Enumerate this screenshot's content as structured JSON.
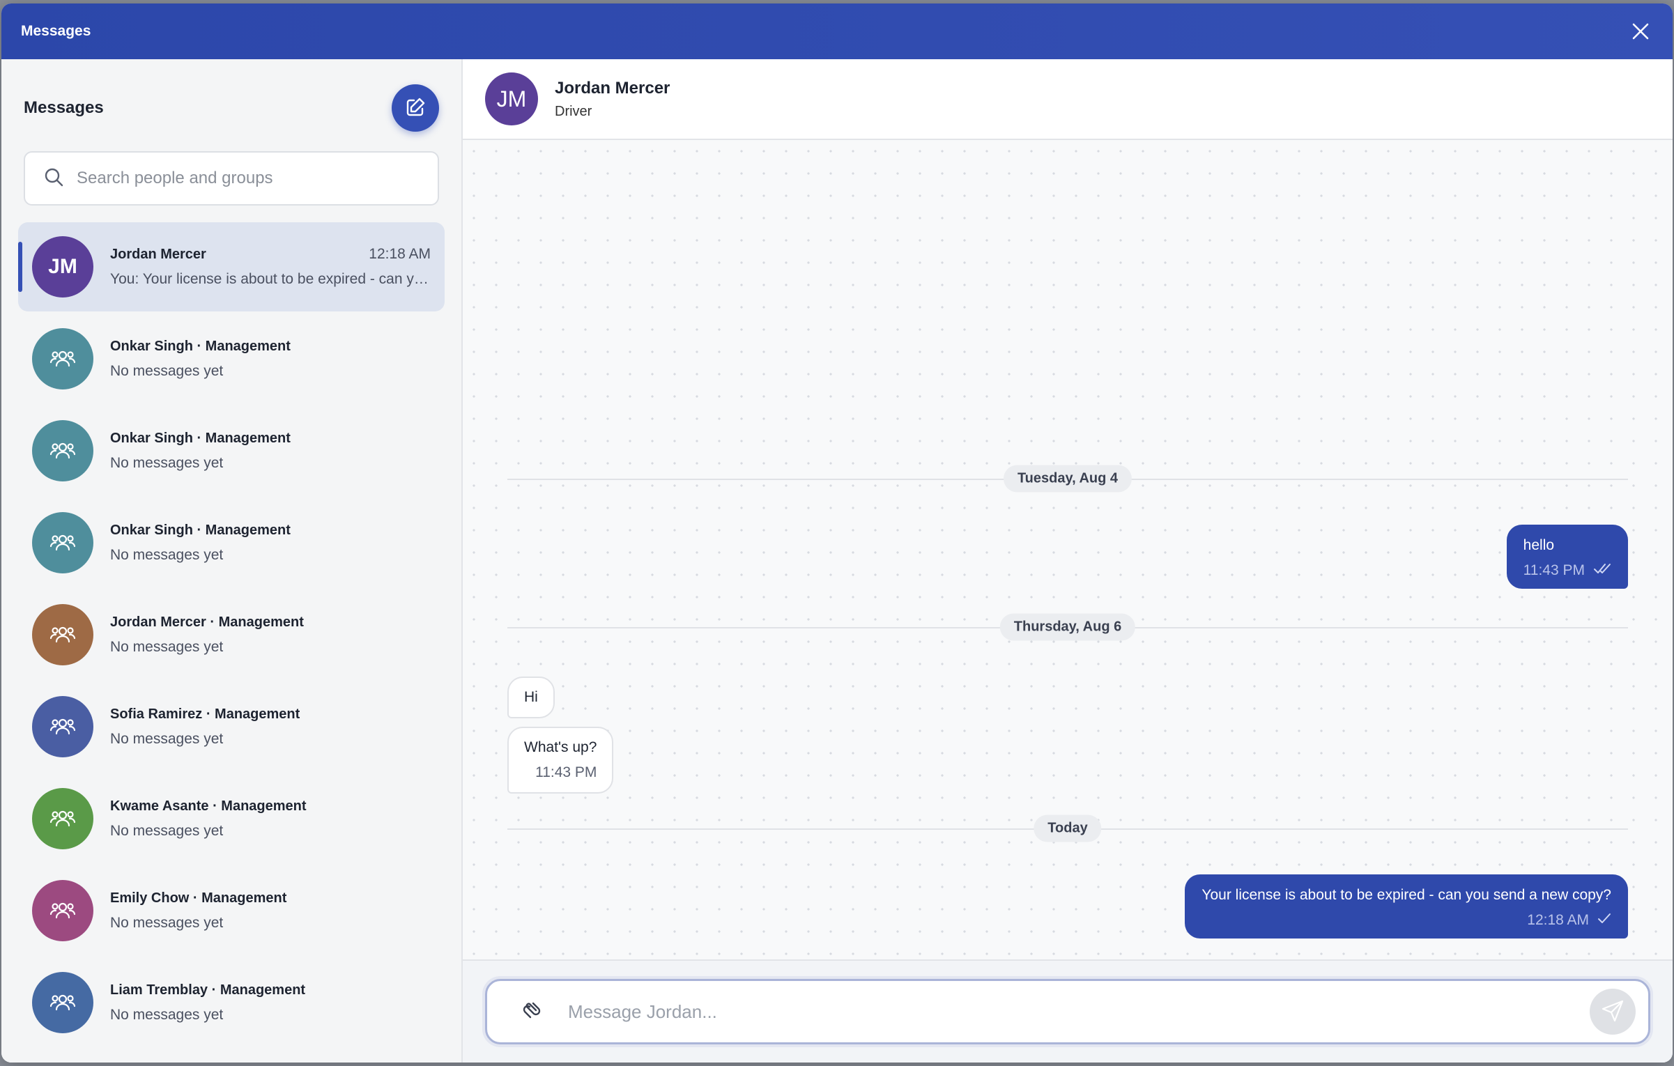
{
  "window": {
    "title": "Messages"
  },
  "sidebar": {
    "title": "Messages",
    "search_placeholder": "Search people and groups",
    "conversations": [
      {
        "name": "Jordan Mercer",
        "time": "12:18 AM",
        "preview": "You: Your license is about to be expired - can you send a new copy?",
        "initials": "JM",
        "color": "#5a3f98",
        "type": "person",
        "active": true
      },
      {
        "name": "Onkar Singh · Management",
        "time": "",
        "preview": "No messages yet",
        "initials": "",
        "color": "#4f8e9c",
        "type": "group",
        "active": false
      },
      {
        "name": "Onkar Singh · Management",
        "time": "",
        "preview": "No messages yet",
        "initials": "",
        "color": "#4f8e9c",
        "type": "group",
        "active": false
      },
      {
        "name": "Onkar Singh · Management",
        "time": "",
        "preview": "No messages yet",
        "initials": "",
        "color": "#4f8e9c",
        "type": "group",
        "active": false
      },
      {
        "name": "Jordan Mercer · Management",
        "time": "",
        "preview": "No messages yet",
        "initials": "",
        "color": "#9e6a45",
        "type": "group",
        "active": false
      },
      {
        "name": "Sofia Ramirez · Management",
        "time": "",
        "preview": "No messages yet",
        "initials": "",
        "color": "#4a5ea3",
        "type": "group",
        "active": false
      },
      {
        "name": "Kwame Asante · Management",
        "time": "",
        "preview": "No messages yet",
        "initials": "",
        "color": "#5a9a48",
        "type": "group",
        "active": false
      },
      {
        "name": "Emily Chow · Management",
        "time": "",
        "preview": "No messages yet",
        "initials": "",
        "color": "#9c4a80",
        "type": "group",
        "active": false
      },
      {
        "name": "Liam Tremblay · Management",
        "time": "",
        "preview": "No messages yet",
        "initials": "",
        "color": "#456aa3",
        "type": "group",
        "active": false
      }
    ]
  },
  "chat": {
    "header": {
      "initials": "JM",
      "name": "Jordan Mercer",
      "role": "Driver",
      "color": "#5a3f98"
    },
    "dividers": [
      "Tuesday, Aug 4",
      "Thursday, Aug 6",
      "Today"
    ],
    "messages": [
      {
        "direction": "out",
        "text": "hello",
        "time": "11:43 PM",
        "status": "read"
      },
      {
        "direction": "in",
        "text": "Hi",
        "time": ""
      },
      {
        "direction": "in",
        "text": "What's up?",
        "time": "11:43 PM"
      },
      {
        "direction": "out",
        "text": "Your license is about to be expired - can you send a new copy?",
        "time": "12:18 AM",
        "status": "sent"
      }
    ],
    "composer_placeholder": "Message Jordan..."
  },
  "icons": {
    "close": "close-icon",
    "compose": "edit-icon",
    "search": "search-icon",
    "group": "group-icon",
    "attach": "paperclip-icon",
    "send": "send-icon",
    "read": "double-check-icon",
    "sent": "check-icon"
  },
  "colors": {
    "brand": "#3550b5",
    "bubble_out": "#2f49ab",
    "active_row": "#dde3ef"
  }
}
